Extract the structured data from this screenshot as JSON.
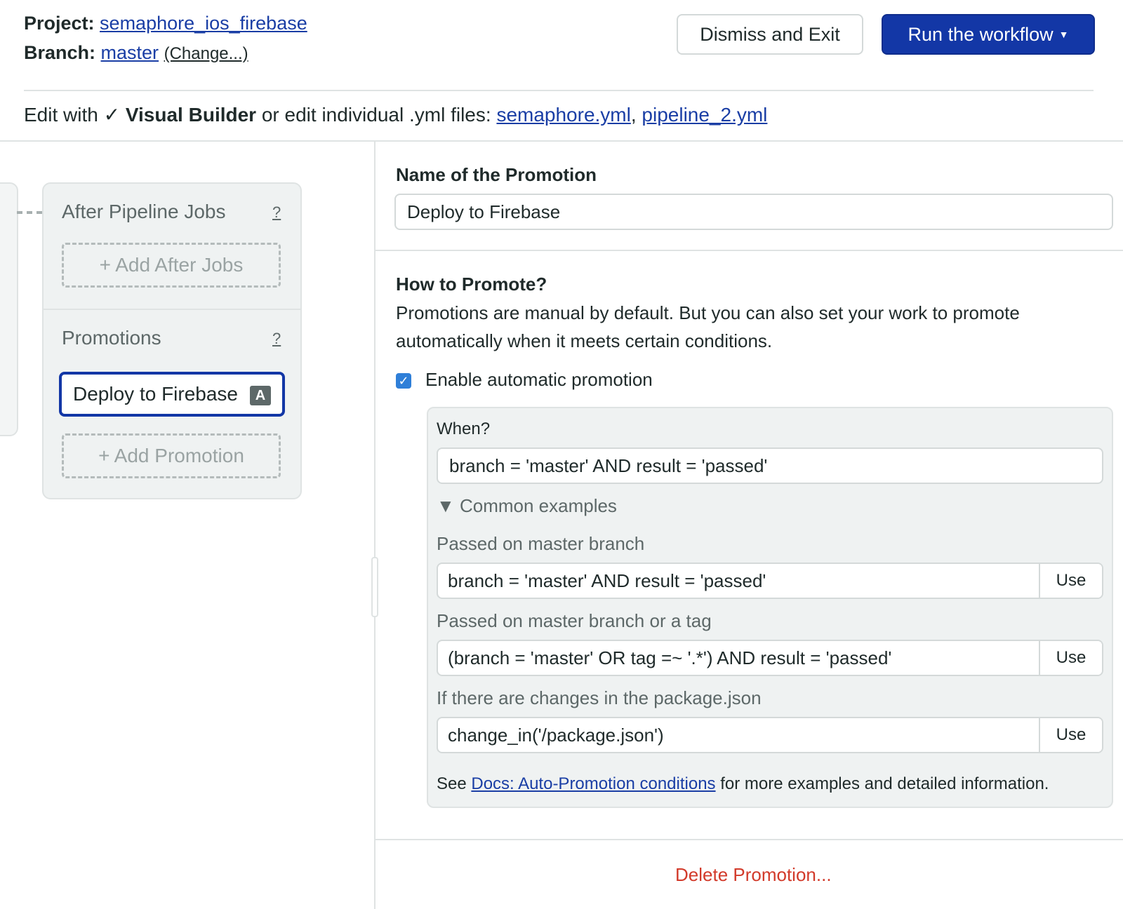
{
  "header": {
    "project_label": "Project:",
    "project_name": "semaphore_ios_firebase",
    "branch_label": "Branch:",
    "branch_name": "master",
    "change_label": "(Change...)",
    "dismiss_label": "Dismiss and Exit",
    "run_label": "Run the workflow"
  },
  "edit_bar": {
    "prefix": "Edit with ",
    "check": "✓",
    "builder_label": "Visual Builder",
    "middle": " or edit individual .yml files: ",
    "file_1": "semaphore.yml",
    "separator": ", ",
    "file_2": "pipeline_2.yml"
  },
  "canvas": {
    "after_jobs_title": "After Pipeline Jobs",
    "after_jobs_help": "?",
    "add_after_jobs": "+ Add After Jobs",
    "promotions_title": "Promotions",
    "promotions_help": "?",
    "promotion_item": "Deploy to Firebase",
    "promotion_badge": "A",
    "add_promotion": "+ Add Promotion"
  },
  "panel": {
    "name_label": "Name of the Promotion",
    "name_value": "Deploy to Firebase",
    "how_title": "How to Promote?",
    "how_desc": "Promotions are manual by default. But you can also set your work to promote automatically when it meets certain conditions.",
    "enable_label": "Enable automatic promotion",
    "enable_checked": true,
    "when_label": "When?",
    "when_value": "branch = 'master' AND result = 'passed'",
    "examples_toggle": "▼ Common examples",
    "examples": [
      {
        "label": "Passed on master branch",
        "value": "branch = 'master' AND result = 'passed'",
        "button": "Use"
      },
      {
        "label": "Passed on master branch or a tag",
        "value": "(branch = 'master' OR tag =~ '.*') AND result = 'passed'",
        "button": "Use"
      },
      {
        "label": "If there are changes in the package.json",
        "value": "change_in('/package.json')",
        "button": "Use"
      }
    ],
    "docs_prefix": "See ",
    "docs_link": "Docs: Auto-Promotion conditions",
    "docs_suffix": " for more examples and detailed information.",
    "delete_label": "Delete Promotion..."
  },
  "colors": {
    "accent": "#1337a6",
    "link": "#1a3ea5",
    "danger": "#d23a2a",
    "checkbox": "#2f7fd8"
  }
}
